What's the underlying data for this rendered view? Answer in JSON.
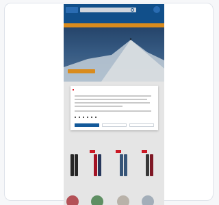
{
  "nav": {
    "items": [
      "",
      "",
      "",
      "",
      "",
      "",
      "",
      "",
      "",
      ""
    ]
  },
  "hero": {
    "headline": "",
    "cta": ""
  },
  "section": {
    "title": ""
  },
  "products": {
    "row1_title": "",
    "row2_title": ""
  },
  "cookie_modal": {
    "title": "",
    "options": [
      "",
      "",
      "",
      "",
      "",
      ""
    ],
    "buttons": [
      "",
      "",
      ""
    ]
  },
  "colors": {
    "header_blue": "#13599a",
    "accent_orange": "#f29b21",
    "sale_red": "#e11c2a"
  }
}
